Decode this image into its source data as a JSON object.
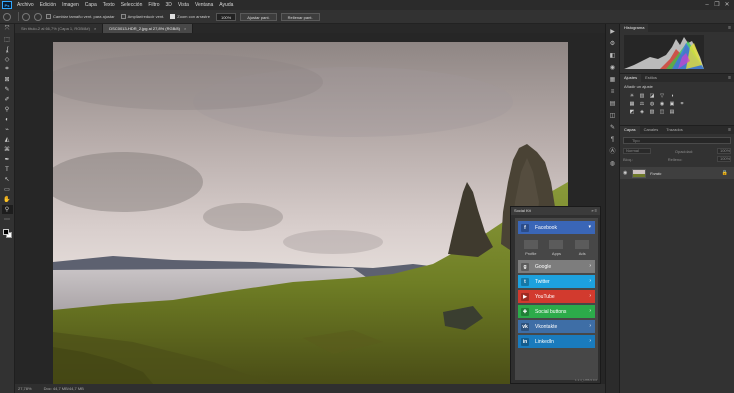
{
  "menubar": {
    "logo": "Ps",
    "items": [
      "Archivo",
      "Edición",
      "Imagen",
      "Capa",
      "Texto",
      "Selección",
      "Filtro",
      "3D",
      "Vista",
      "Ventana",
      "Ayuda"
    ],
    "controls": [
      "–",
      "❐",
      "✕"
    ]
  },
  "options": {
    "checkboxes": [
      {
        "label": "Cambiar tamaño vent. para ajustar",
        "checked": false
      },
      {
        "label": "Ampliar/reducir vent.",
        "checked": false
      },
      {
        "label": "Zoom con arrastre",
        "checked": true
      }
    ],
    "zoom_value": "100%",
    "fit_button": "Ajustar pant.",
    "fill_button": "Rellenar pant."
  },
  "tabs": [
    {
      "label": "Sin título-2 al 66,7% (Capa 1, RGB/8#)",
      "active": false
    },
    {
      "label": "DSC0013-HDR_2.jpg al 27,8% (RGB/8)",
      "active": true
    }
  ],
  "tools": [
    "⤧",
    "⬚",
    "ʆ",
    "◇",
    "⌗",
    "⊠",
    "✎",
    "✐",
    "⚲",
    "◐",
    "⌁",
    "◭",
    "⌘",
    "✒",
    "T",
    "↖",
    "▭",
    "✋",
    "⚲",
    "⋯"
  ],
  "status": {
    "zoom": "27,78%",
    "doc": "Doc: 44,7 MB/44,7 MB"
  },
  "iconcol": [
    "▶",
    "⚙",
    "◧",
    "◉",
    "▦",
    "≡",
    "▤",
    "◫",
    "✎",
    "¶",
    "Ⓐ",
    "◍"
  ],
  "panels": {
    "histogram_tabs": [
      "Histograma"
    ],
    "adjust_tabs": [
      "Ajustes",
      "Estilos"
    ],
    "adjust_title": "Añadir un ajuste",
    "adjust_row1": [
      "☀",
      "▥",
      "◪",
      "▽",
      "◑"
    ],
    "adjust_row2": [
      "▦",
      "⚖",
      "◍",
      "◉",
      "▣",
      "⌗"
    ],
    "adjust_row3": [
      "◩",
      "◈",
      "▧",
      "◫",
      "▤"
    ],
    "layers_tabs": [
      "Capas",
      "Canales",
      "Trazados"
    ],
    "search_placeholder": "Tipo",
    "blend_mode": "Normal",
    "opacity_label": "Opacidad:",
    "opacity_value": "100%",
    "lock_label": "Bloq.:",
    "fill_label": "Relleno:",
    "fill_value": "100%",
    "layer_name": "Fondo",
    "bottom_icons": [
      "⛓",
      "fx",
      "◐",
      "◑",
      "▭",
      "▣",
      "🗑"
    ]
  },
  "social": {
    "title": "Social Kit",
    "footer": "1.1.4_HTB-5.0.0",
    "sub_labels": [
      "Profile",
      "Apps",
      "Ads"
    ],
    "items": [
      {
        "label": "Facebook",
        "icon": "f",
        "color": "#3a66b7"
      },
      {
        "label": "Google",
        "icon": "g",
        "color": "#7d7d7d"
      },
      {
        "label": "Twitter",
        "icon": "t",
        "color": "#1da1de"
      },
      {
        "label": "YouTube",
        "icon": "▶",
        "color": "#d23a2e"
      },
      {
        "label": "Social buttons",
        "icon": "✚",
        "color": "#2cab4a"
      },
      {
        "label": "Vkontakte",
        "icon": "vk",
        "color": "#3e6ea6"
      },
      {
        "label": "LinkedIn",
        "icon": "in",
        "color": "#1a7bbd"
      }
    ]
  }
}
